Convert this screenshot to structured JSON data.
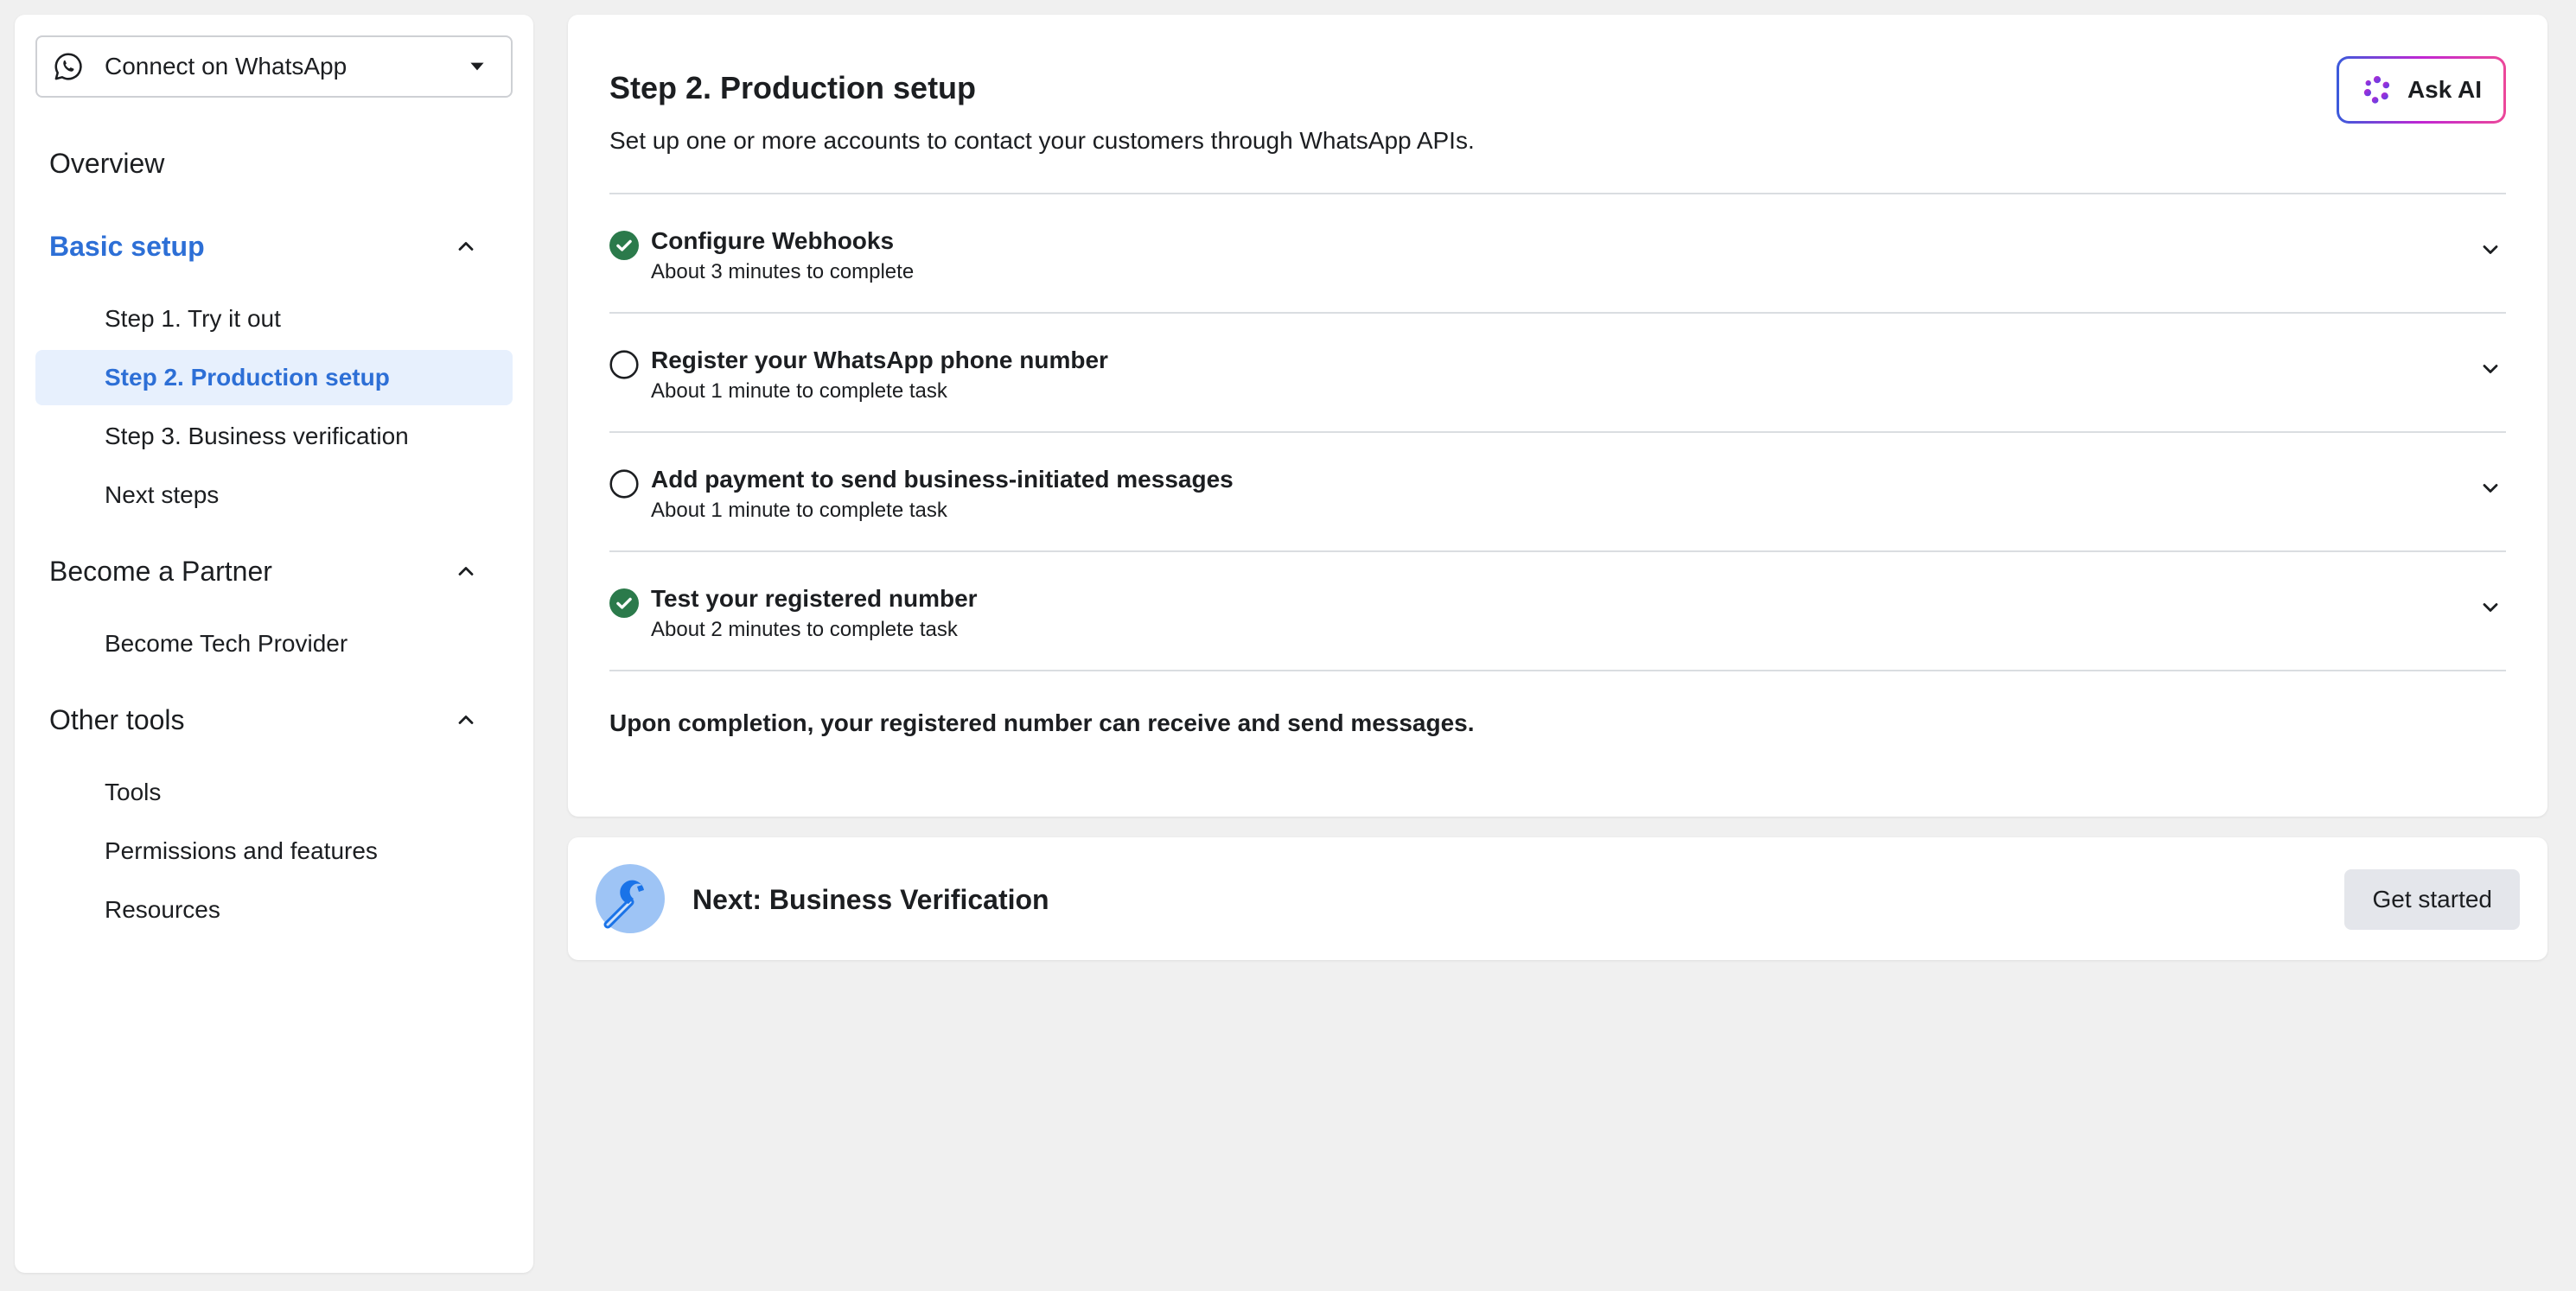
{
  "sidebar": {
    "product_select": {
      "label": "Connect on WhatsApp"
    },
    "overview": "Overview",
    "sections": [
      {
        "label": "Basic setup",
        "items": [
          "Step 1. Try it out",
          "Step 2. Production setup",
          "Step 3. Business verification",
          "Next steps"
        ]
      },
      {
        "label": "Become a Partner",
        "items": [
          "Become Tech Provider"
        ]
      },
      {
        "label": "Other tools",
        "items": [
          "Tools",
          "Permissions and features",
          "Resources"
        ]
      }
    ]
  },
  "main": {
    "title": "Step 2. Production setup",
    "subtitle": "Set up one or more accounts to contact your customers through WhatsApp APIs.",
    "ask_ai": "Ask AI",
    "tasks": [
      {
        "title": "Configure Webhooks",
        "subtitle": "About 3 minutes to complete",
        "status": "complete"
      },
      {
        "title": "Register your WhatsApp phone number",
        "subtitle": "About 1 minute to complete task",
        "status": "incomplete"
      },
      {
        "title": "Add payment to send business-initiated messages",
        "subtitle": "About 1 minute to complete task",
        "status": "incomplete"
      },
      {
        "title": "Test your registered number",
        "subtitle": "About 2 minutes to complete task",
        "status": "complete"
      }
    ],
    "completion_note": "Upon completion, your registered number can receive and send messages."
  },
  "next": {
    "title": "Next: Business Verification",
    "button": "Get started"
  },
  "colors": {
    "accent": "#2d6fd6",
    "selected_bg": "#e7f0fd",
    "complete_green": "#2b7a4b",
    "page_bg": "#f0f0f0"
  }
}
